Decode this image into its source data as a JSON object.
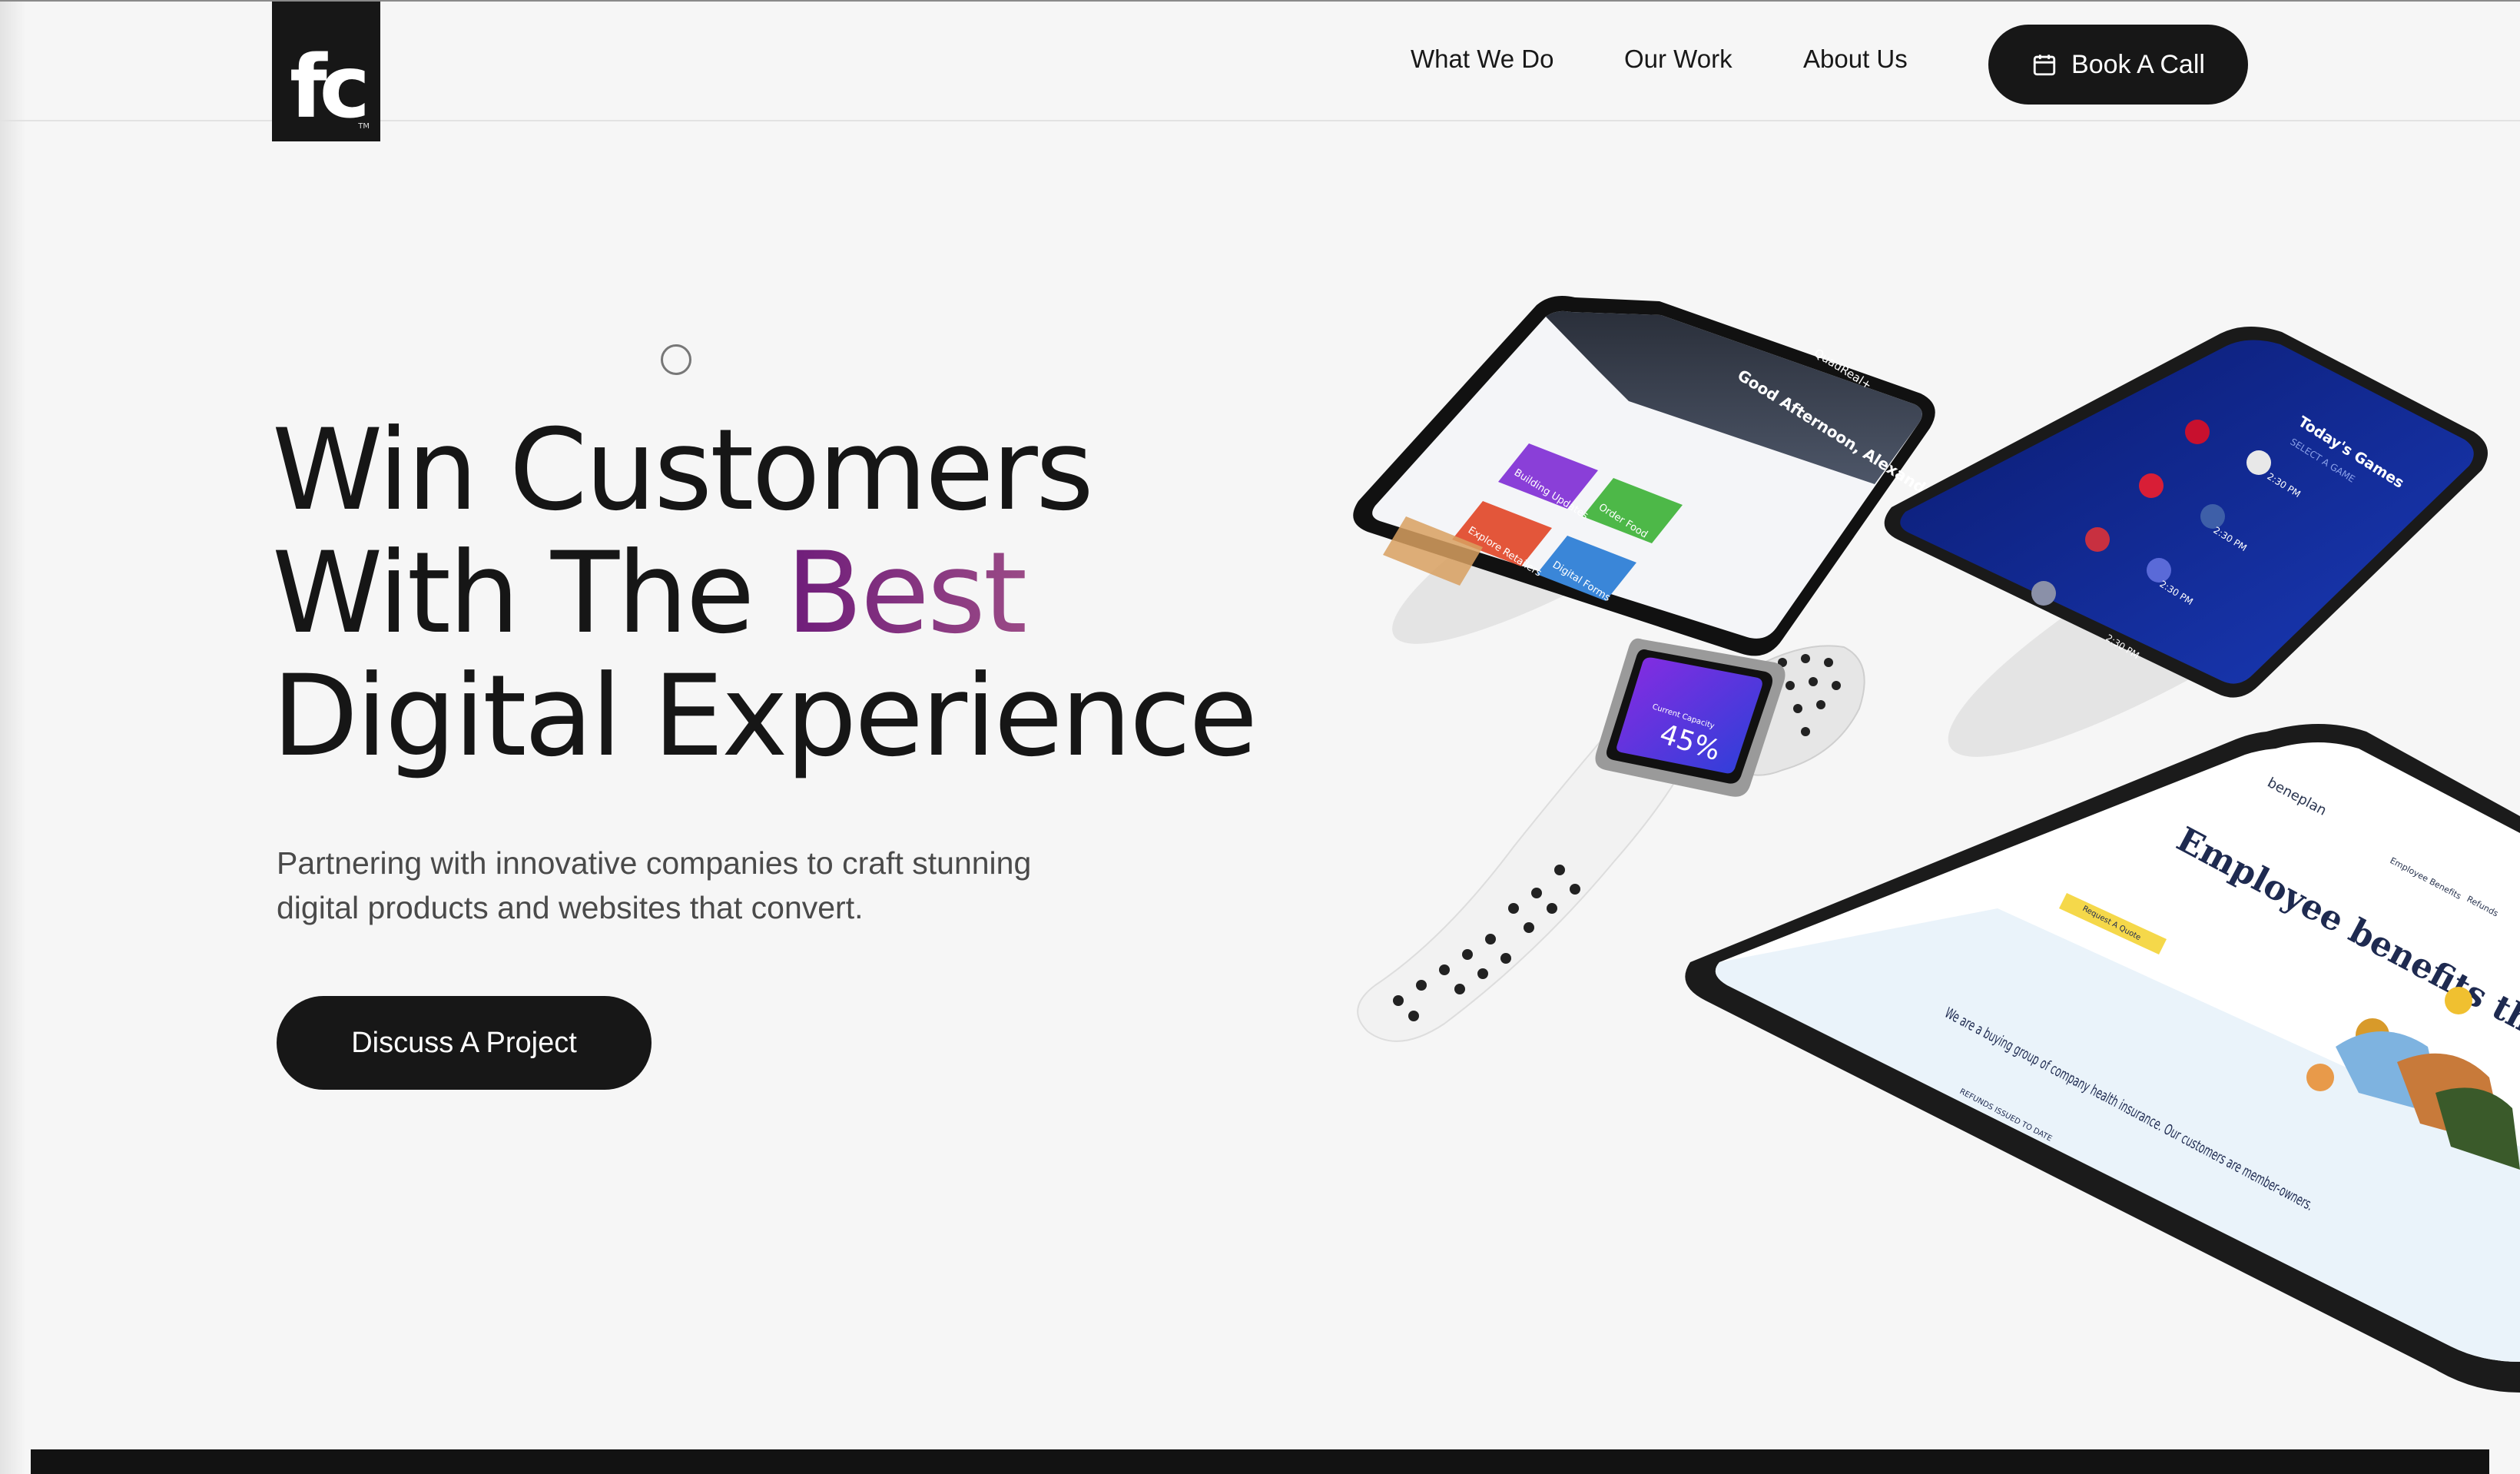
{
  "brand": {
    "logo_text": "fc",
    "logo_mark": "TM"
  },
  "nav": {
    "items": [
      {
        "label": "What We Do"
      },
      {
        "label": "Our Work"
      },
      {
        "label": "About Us"
      }
    ],
    "cta_label": "Book A Call",
    "cta_icon": "calendar-icon"
  },
  "hero": {
    "title_line1": "Win Customers",
    "title_line2_pre": "With The ",
    "title_line2_accent": "Best",
    "title_line3": "Digital Experience",
    "subtitle": "Partnering with innovative companies to craft stunning digital products and websites that convert.",
    "cta_label": "Discuss A Project"
  },
  "mockups": {
    "phone1": {
      "greeting": "Good Afternoon, Alexandra",
      "brand": "QuadReal+",
      "tiles": [
        "Building Updates",
        "Order Food",
        "Explore Retailers",
        "Digital Forms"
      ]
    },
    "phone2": {
      "title": "Today's Games",
      "subtitle": "SELECT A GAME",
      "times": [
        "2:30 PM",
        "2:30 PM",
        "2:30 PM",
        "2:30 PM"
      ]
    },
    "watch": {
      "value": "45%",
      "caption": "Current Capacity"
    },
    "tablet": {
      "brand": "beneplan",
      "headline": "Employee benefits that pay back",
      "cta": "Request A Quote",
      "tagline": "We are a buying group of company health insurance. Our customers are member-owners.",
      "label": "REFUNDS ISSUED TO DATE",
      "nav_items": [
        "Employee Benefits",
        "Refunds"
      ]
    }
  },
  "colors": {
    "accent_start": "#6e1c7a",
    "accent_end": "#9a4a86",
    "dark": "#171717",
    "background": "#f6f6f6"
  }
}
